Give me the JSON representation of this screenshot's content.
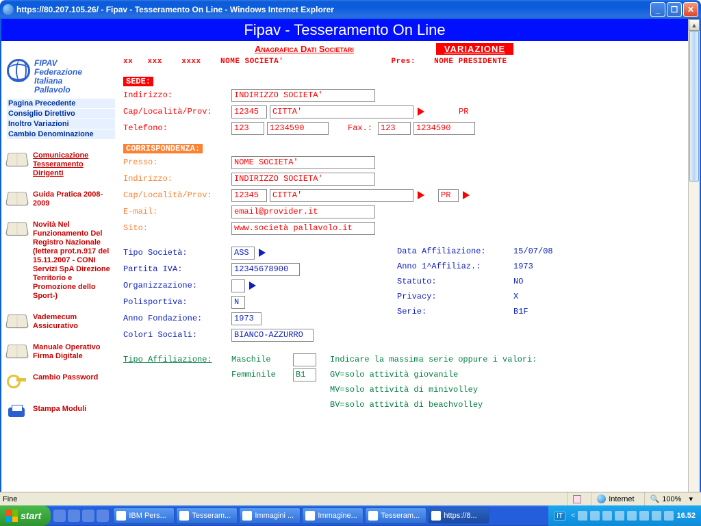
{
  "window": {
    "title": "https://80.207.105.26/ - Fipav - Tesseramento On Line - Windows Internet Explorer"
  },
  "banner": "Fipav - Tesseramento On Line",
  "subheader": {
    "title": "Anagrafica Dati Societari",
    "badge": "VARIAZIONE"
  },
  "logo": {
    "l1": "FIPAV",
    "l2": "Federazione",
    "l3": "Italiana",
    "l4": "Pallavolo"
  },
  "nav": {
    "prev": "Pagina Precedente",
    "cons": "Consiglio Direttivo",
    "inol": "Inoltro Variazioni",
    "camb": "Cambio Denominazione"
  },
  "side": {
    "com": "Comunicazione Tesseramento Dirigenti",
    "guida": "Guida Pratica 2008-2009",
    "novita": "Novità Nel Funzionamento Del Registro Nazionale (lettera prot.n.917 del 15.11.2007 - CONI Servizi SpA Direzione Territorio e Promozione dello Sport-)",
    "vade": "Vademecum Assicurativo",
    "manuale": "Manuale Operativo Firma Digitale",
    "pwd": "Cambio Password",
    "stampa": "Stampa Moduli"
  },
  "codes": {
    "xx": "xx",
    "xxx": "xxx",
    "xxxx": "xxxx",
    "nome": "NOME SOCIETA'",
    "pres_lbl": "Pres:",
    "pres_val": "NOME PRESIDENTE"
  },
  "sede": {
    "hdr": "SEDE:",
    "indirizzo_lbl": "Indirizzo:",
    "indirizzo": "INDIRIZZO SOCIETA'",
    "cap_lbl": "Cap/Località/Prov:",
    "cap": "12345",
    "citta": "CITTA'",
    "prov": "PR",
    "tel_lbl": "Telefono:",
    "tel_pre": "123",
    "tel": "1234590",
    "fax_lbl": "Fax.:",
    "fax_pre": "123",
    "fax": "1234590"
  },
  "corr": {
    "hdr": "CORRISPONDENZA:",
    "presso_lbl": "Presso:",
    "presso": "NOME SOCIETA'",
    "indirizzo_lbl": "Indirizzo:",
    "indirizzo": "INDIRIZZO SOCIETA'",
    "cap_lbl": "Cap/Località/Prov:",
    "cap": "12345",
    "citta": "CITTA'",
    "prov": "PR",
    "email_lbl": "E-mail:",
    "email": "email@provider.it",
    "sito_lbl": "Sito:",
    "sito": "www.società pallavolo.it"
  },
  "soc": {
    "tipo_lbl": "Tipo Società:",
    "tipo": "ASS",
    "piva_lbl": "Partita IVA:",
    "piva": "12345678900",
    "org_lbl": "Organizzazione:",
    "org": "",
    "poli_lbl": "Polisportiva:",
    "poli": "N",
    "anno_lbl": "Anno Fondazione:",
    "anno": "1973",
    "colori_lbl": "Colori Sociali:",
    "colori": "BIANCO-AZZURRO"
  },
  "right": {
    "dataaff_lbl": "Data Affiliazione:",
    "dataaff": "15/07/08",
    "anno1_lbl": "Anno 1^Affiliaz.:",
    "anno1": "1973",
    "statuto_lbl": "Statuto:",
    "statuto": "NO",
    "privacy_lbl": "Privacy:",
    "privacy": "X",
    "serie_lbl": "Serie:",
    "serie": "B1F"
  },
  "aff": {
    "hdr": "Tipo Affiliazione:",
    "m_lbl": "Maschile",
    "m_val": "",
    "f_lbl": "Femminile",
    "f_val": "B1",
    "note1": "Indicare la massima serie oppure i valori:",
    "note2": "GV=solo attività giovanile",
    "note3": "MV=solo attività di minivolley",
    "note4": "BV=solo attività di beachvolley"
  },
  "status": {
    "left": "Fine",
    "zone": "Internet",
    "zoom": "100%",
    "tri": "▾"
  },
  "taskbar": {
    "start": "start",
    "tasks": [
      "IBM Pers...",
      "Tesseram...",
      "Immagini ...",
      "Immagine...",
      "Tesseram...",
      "https://8..."
    ],
    "lang": "IT",
    "clock": "16.52"
  }
}
